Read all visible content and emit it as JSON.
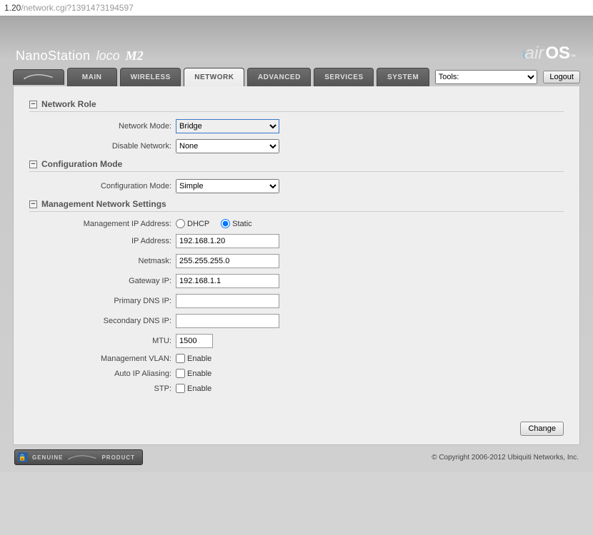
{
  "browser": {
    "url_prefix": "1.20",
    "url_path": "/network.cgi?1391473194597"
  },
  "header": {
    "product_line": "NanoStation",
    "variant": "loco",
    "model": "M2",
    "os_brand_air": "air",
    "os_brand_os": "OS",
    "tm": "™"
  },
  "tabs": {
    "main": "MAIN",
    "wireless": "WIRELESS",
    "network": "NETWORK",
    "advanced": "ADVANCED",
    "services": "SERVICES",
    "system": "SYSTEM",
    "tools_default": "Tools:",
    "logout": "Logout"
  },
  "sections": {
    "network_role": {
      "title": "Network Role",
      "network_mode_label": "Network Mode:",
      "network_mode_value": "Bridge",
      "disable_network_label": "Disable Network:",
      "disable_network_value": "None"
    },
    "config_mode": {
      "title": "Configuration Mode",
      "mode_label": "Configuration Mode:",
      "mode_value": "Simple"
    },
    "mgmt": {
      "title": "Management Network Settings",
      "ip_mode_label": "Management IP Address:",
      "ip_mode_dhcp": "DHCP",
      "ip_mode_static": "Static",
      "ip_label": "IP Address:",
      "ip_value": "192.168.1.20",
      "netmask_label": "Netmask:",
      "netmask_value": "255.255.255.0",
      "gateway_label": "Gateway IP:",
      "gateway_value": "192.168.1.1",
      "pdns_label": "Primary DNS IP:",
      "pdns_value": "",
      "sdns_label": "Secondary DNS IP:",
      "sdns_value": "",
      "mtu_label": "MTU:",
      "mtu_value": "1500",
      "vlan_label": "Management VLAN:",
      "autoip_label": "Auto IP Aliasing:",
      "stp_label": "STP:",
      "enable_text": "Enable"
    }
  },
  "actions": {
    "change": "Change"
  },
  "footer": {
    "badge": "GENUINE",
    "badge2": "PRODUCT",
    "copyright": "© Copyright 2006-2012 Ubiquiti Networks, Inc."
  }
}
